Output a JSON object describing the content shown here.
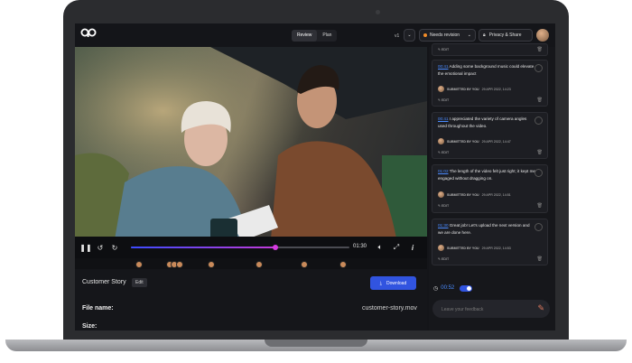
{
  "header": {
    "tabs": [
      "Review",
      "Plan"
    ],
    "active_tab": "Review",
    "version": "v1",
    "status": "Needs revision",
    "privacy": "Privacy & Share"
  },
  "player": {
    "time": "01:30",
    "progress_fraction": 0.66
  },
  "details": {
    "title": "Customer Story",
    "edit_label": "Edit",
    "download_label": "Download",
    "file_name_label": "File name:",
    "file_name_value": "customer-story.mov",
    "size_label": "Size:"
  },
  "comments": [
    {
      "edit": "EDIT"
    },
    {
      "timestamp": "00:41",
      "text": "Adding some background music could elevate the emotional impact",
      "submitted": "SUBMITTED BY YOU",
      "date": "29 APR 2022, 14:23",
      "edit": "EDIT"
    },
    {
      "timestamp": "00:41",
      "text": "I appreciated the variety of camera angles used throughout the video.",
      "submitted": "SUBMITTED BY YOU",
      "date": "29 APR 2022, 14:47",
      "edit": "EDIT"
    },
    {
      "timestamp": "01:02",
      "text": "The length of the video felt just right; it kept me engaged without dragging on.",
      "submitted": "SUBMITTED BY YOU",
      "date": "29 APR 2022, 14:51",
      "edit": "EDIT"
    },
    {
      "timestamp": "01:30",
      "text": "Great job! Let's upload the next version and we are done here.",
      "submitted": "SUBMITTED BY YOU",
      "date": "29 APR 2022, 14:53",
      "edit": "EDIT"
    }
  ],
  "composer": {
    "time": "00:52",
    "placeholder": "Leave your feedback"
  },
  "colors": {
    "accent": "#3154e0",
    "status_dot": "#f28c28",
    "timestamp": "#4a8bff"
  }
}
